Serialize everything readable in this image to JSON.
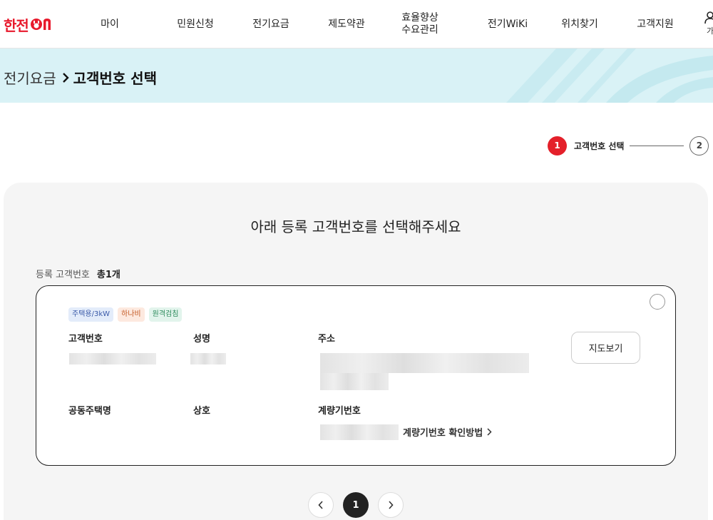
{
  "header": {
    "logo_text": "한전",
    "nav": [
      {
        "label": "마이"
      },
      {
        "label": "민원신청"
      },
      {
        "label": "전기요금"
      },
      {
        "label": "제도약관"
      },
      {
        "label": "효율향상\n수요관리"
      },
      {
        "label": "전기WiKi"
      },
      {
        "label": "위치찾기"
      },
      {
        "label": "고객지원"
      }
    ],
    "user_label": "가"
  },
  "breadcrumb": {
    "parent": "전기요금",
    "current": "고객번호 선택"
  },
  "stepper": {
    "steps": [
      {
        "number": "1",
        "label": "고객번호 선택",
        "active": true
      },
      {
        "number": "2",
        "active": false
      }
    ]
  },
  "main": {
    "title": "아래 등록 고객번호를 선택해주세요",
    "count_label": "등록 고객번호",
    "count_value": "총1개"
  },
  "card": {
    "tags": [
      "주택용/3kW",
      "하나비",
      "원격검침"
    ],
    "fields": {
      "customer_no": "고객번호",
      "name": "성명",
      "address": "주소",
      "apartment": "공동주택명",
      "business": "상호",
      "meter_no": "계량기번호"
    },
    "map_button": "지도보기",
    "meter_link": "계량기번호 확인방법"
  },
  "pagination": {
    "current_page": "1"
  },
  "colors": {
    "brand_red": "#e4202a",
    "banner_bg": "#d9f2f6"
  }
}
